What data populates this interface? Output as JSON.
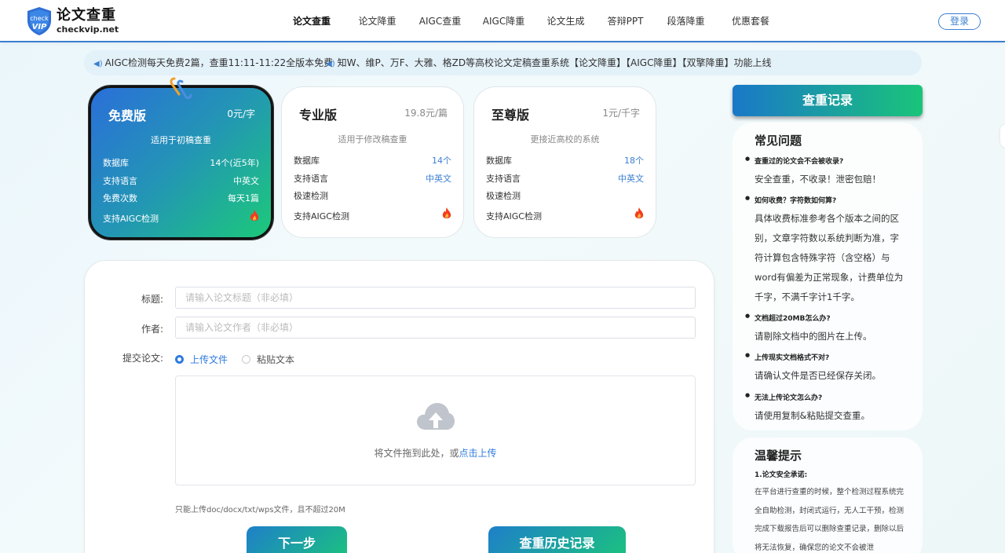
{
  "header": {
    "logo_title": "论文查重",
    "logo_sub": "checkvip.net",
    "logo_badge_top": "check",
    "logo_badge_bottom": "VIP",
    "nav": [
      "论文查重",
      "论文降重",
      "AIGC查重",
      "AIGC降重",
      "论文生成",
      "答辩PPT",
      "段落降重",
      "优惠套餐"
    ],
    "login": "登录"
  },
  "notice": {
    "item1": "AIGC检测每天免费2篇，查重11:11-11:22全版本免费",
    "item2": "知W、维P、万F、大雅、格ZD等高校论文定稿查重系统【论文降重】【AIGC降重】【双擎降重】功能上线"
  },
  "plans": [
    {
      "title": "免费版",
      "price": "0元/字",
      "subtitle": "适用于初稿查重",
      "rows": [
        {
          "label": "数据库",
          "value": "14个(近5年)"
        },
        {
          "label": "支持语言",
          "value": "中英文"
        },
        {
          "label": "免费次数",
          "value": "每天1篇"
        },
        {
          "label": "支持AIGC检测",
          "value": ""
        }
      ]
    },
    {
      "title": "专业版",
      "price": "19.8元/篇",
      "subtitle": "适用于修改稿查重",
      "rows": [
        {
          "label": "数据库",
          "value": "14个"
        },
        {
          "label": "支持语言",
          "value": "中英文"
        },
        {
          "label": "极速检测",
          "value": ""
        },
        {
          "label": "支持AIGC检测",
          "value": ""
        }
      ]
    },
    {
      "title": "至尊版",
      "price": "1元/千字",
      "subtitle": "更接近高校的系统",
      "rows": [
        {
          "label": "数据库",
          "value": "18个"
        },
        {
          "label": "支持语言",
          "value": "中英文"
        },
        {
          "label": "极速检测",
          "value": ""
        },
        {
          "label": "支持AIGC检测",
          "value": ""
        }
      ]
    }
  ],
  "form": {
    "title_label": "标题:",
    "title_placeholder": "请输入论文标题（非必填）",
    "author_label": "作者:",
    "author_placeholder": "请输入论文作者（非必填）",
    "submit_label": "提交论文:",
    "radio_upload": "上传文件",
    "radio_paste": "粘贴文本",
    "upload_text": "将文件拖到此处，或",
    "upload_link": "点击上传",
    "hint": "只能上传doc/docx/txt/wps文件，且不超过20M",
    "next_button": "下一步",
    "history_button": "查重历史记录"
  },
  "sidebar": {
    "record_button": "查重记录",
    "faq_title": "常见问题",
    "faq": [
      {
        "q": "查重过的论文会不会被收录?",
        "a": "安全查重，不收录！泄密包赔！"
      },
      {
        "q": "如何收费？字符数如何算?",
        "a": "具体收费标准参考各个版本之间的区别，文章字符数以系统判断为准，字符计算包含特殊字符（含空格）与word有偏差为正常现象，计费单位为千字，不满千字计1千字。"
      },
      {
        "q": "文档超过20MB怎么办?",
        "a": "请剔除文档中的图片在上传。"
      },
      {
        "q": "上传现实文档格式不对?",
        "a": "请确认文件是否已经保存关闭。"
      },
      {
        "q": "无法上传论文怎么办?",
        "a": "请使用复制&粘贴提交查重。"
      }
    ],
    "tips_title": "温馨提示",
    "tips_sub": "1.论文安全承诺:",
    "tips_text": "在平台进行查重的时候，整个检测过程系统完全自助检测，封闭式运行，无人工干预，检测完成下载报告后可以删除查重记录，删除以后将无法恢复，确保您的论文不会被泄"
  },
  "colors": {
    "accent": "#2f7be0",
    "gradient_start": "#1e7fc9",
    "gradient_end": "#1bc57c"
  }
}
